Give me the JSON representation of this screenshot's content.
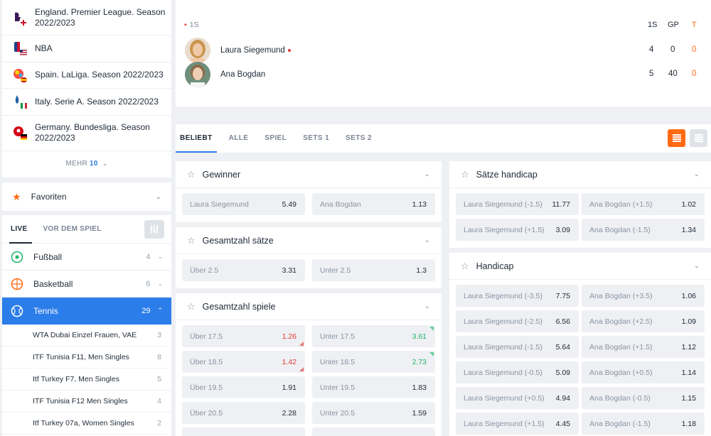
{
  "sidebar": {
    "leagues": [
      {
        "name": "England. Premier League. Season 2022/2023",
        "icon": "premier-league-logo"
      },
      {
        "name": "NBA",
        "icon": "nba-logo"
      },
      {
        "name": "Spain. LaLiga. Season 2022/2023",
        "icon": "laliga-logo"
      },
      {
        "name": "Italy. Serie A. Season 2022/2023",
        "icon": "serie-a-logo"
      },
      {
        "name": "Germany. Bundesliga. Season 2022/2023",
        "icon": "bundesliga-logo"
      }
    ],
    "more": {
      "label": "MEHR",
      "count": "10"
    },
    "favorites": {
      "label": "Favoriten"
    },
    "tabs": {
      "live": "LIVE",
      "prematch": "VOR DEM SPIEL"
    },
    "sports": [
      {
        "label": "Fußball",
        "count": "4",
        "icon": "football-icon"
      },
      {
        "label": "Basketball",
        "count": "6",
        "icon": "basketball-icon"
      },
      {
        "label": "Tennis",
        "count": "29",
        "icon": "tennis-icon"
      }
    ],
    "tournaments": [
      {
        "label": "WTA Dubai Einzel Frauen, VAE",
        "count": "3"
      },
      {
        "label": "ITF Tunisia F11, Men Singles",
        "count": "8"
      },
      {
        "label": "Itf Turkey F7, Men Singles",
        "count": "5"
      },
      {
        "label": "ITF Tunisia F12 Men Singles",
        "count": "4"
      },
      {
        "label": "Itf Turkey 07a, Women Singles",
        "count": "2"
      }
    ]
  },
  "scoreboard": {
    "set_label": "1S",
    "headers": {
      "set": "1S",
      "games": "GP",
      "tiebreak": "T"
    },
    "players": [
      {
        "name": "Laura Siegemund",
        "set": "4",
        "games": "0",
        "tiebreak": "0",
        "serving": true
      },
      {
        "name": "Ana Bogdan",
        "set": "5",
        "games": "40",
        "tiebreak": "0",
        "serving": false
      }
    ]
  },
  "market_tabs": [
    "BELIEBT",
    "ALLE",
    "SPIEL",
    "SETS 1",
    "SETS 2"
  ],
  "markets_left": [
    {
      "title": "Gewinner",
      "rows": [
        [
          {
            "label": "Laura Siegemund",
            "value": "5.49"
          },
          {
            "label": "Ana Bogdan",
            "value": "1.13"
          }
        ]
      ]
    },
    {
      "title": "Gesamtzahl sätze",
      "rows": [
        [
          {
            "label": "Über 2.5",
            "value": "3.31"
          },
          {
            "label": "Unter 2.5",
            "value": "1.3"
          }
        ]
      ]
    },
    {
      "title": "Gesamtzahl spiele",
      "rows": [
        [
          {
            "label": "Über 17.5",
            "value": "1.26",
            "trend": "down"
          },
          {
            "label": "Unter 17.5",
            "value": "3.61",
            "trend": "up"
          }
        ],
        [
          {
            "label": "Über 18.5",
            "value": "1.42",
            "trend": "down"
          },
          {
            "label": "Unter 18.5",
            "value": "2.73",
            "trend": "up"
          }
        ],
        [
          {
            "label": "Über 19.5",
            "value": "1.91"
          },
          {
            "label": "Unter 19.5",
            "value": "1.83"
          }
        ],
        [
          {
            "label": "Über 20.5",
            "value": "2.28"
          },
          {
            "label": "Unter 20.5",
            "value": "1.59"
          }
        ]
      ]
    }
  ],
  "markets_right": [
    {
      "title": "Sätze handicap",
      "rows": [
        [
          {
            "label": "Laura Siegemund (-1.5)",
            "value": "11.77"
          },
          {
            "label": "Ana Bogdan (+1.5)",
            "value": "1.02"
          }
        ],
        [
          {
            "label": "Laura Siegemund (+1.5)",
            "value": "3.09"
          },
          {
            "label": "Ana Bogdan (-1.5)",
            "value": "1.34"
          }
        ]
      ]
    },
    {
      "title": "Handicap",
      "rows": [
        [
          {
            "label": "Laura Siegemund (-3.5)",
            "value": "7.75"
          },
          {
            "label": "Ana Bogdan (+3.5)",
            "value": "1.06"
          }
        ],
        [
          {
            "label": "Laura Siegemund (-2.5)",
            "value": "6.56"
          },
          {
            "label": "Ana Bogdan (+2.5)",
            "value": "1.09"
          }
        ],
        [
          {
            "label": "Laura Siegemund (-1.5)",
            "value": "5.64"
          },
          {
            "label": "Ana Bogdan (+1.5)",
            "value": "1.12"
          }
        ],
        [
          {
            "label": "Laura Siegemund (-0.5)",
            "value": "5.09"
          },
          {
            "label": "Ana Bogdan (+0.5)",
            "value": "1.14"
          }
        ],
        [
          {
            "label": "Laura Siegemund (+0.5)",
            "value": "4.94"
          },
          {
            "label": "Ana Bogdan (-0.5)",
            "value": "1.15"
          }
        ],
        [
          {
            "label": "Laura Siegemund (+1.5)",
            "value": "4.45"
          },
          {
            "label": "Ana Bogdan (-1.5)",
            "value": "1.18"
          }
        ]
      ]
    }
  ],
  "colors": {
    "accent": "#2b7de9",
    "orange": "#ff6a13",
    "down": "#e53935",
    "up": "#22b36a"
  }
}
